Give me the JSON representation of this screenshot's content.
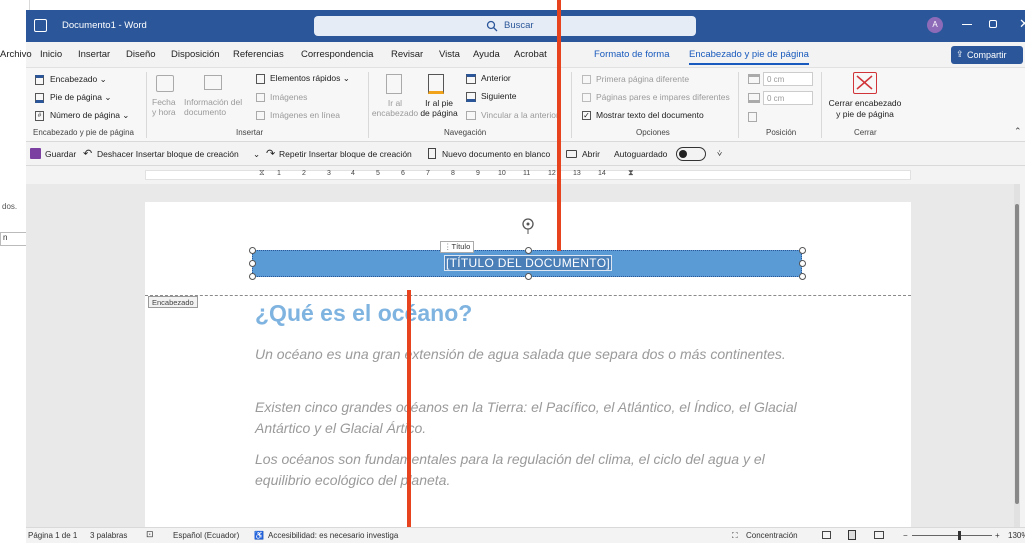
{
  "window": {
    "title": "Documento1 - Word",
    "search_placeholder": "Buscar",
    "avatar_letter": "A"
  },
  "ribbon_tabs": [
    "Archivo",
    "Inicio",
    "Insertar",
    "Diseño",
    "Disposición",
    "Referencias",
    "Correspondencia",
    "Revisar",
    "Vista",
    "Ayuda",
    "Acrobat",
    "Formato de forma",
    "Encabezado y pie de página"
  ],
  "share_label": "Compartir",
  "ribbon": {
    "header_footer_group": {
      "items": [
        "Encabezado",
        "Pie de página",
        "Número de página"
      ],
      "label": "Encabezado y pie de página"
    },
    "insert_group": {
      "date_time": "Fecha y hora",
      "doc_info": "Información del documento",
      "quick_parts": "Elementos rápidos",
      "images": "Imágenes",
      "online_images": "Imágenes en línea",
      "label": "Insertar"
    },
    "navigation_group": {
      "go_header": "Ir al encabezado",
      "go_footer": "Ir al pie de página",
      "previous": "Anterior",
      "next": "Siguiente",
      "link_previous": "Vincular a la anterior",
      "label": "Navegación"
    },
    "options_group": {
      "first_page": "Primera página diferente",
      "odd_even": "Páginas pares e impares diferentes",
      "show_text": "Mostrar texto del documento",
      "label": "Opciones"
    },
    "position_group": {
      "top_value": "0 cm",
      "bottom_value": "0 cm",
      "label": "Posición"
    },
    "close_group": {
      "close_label": "Cerrar encabezado y pie de página",
      "label": "Cerrar"
    }
  },
  "qat": {
    "save": "Guardar",
    "undo": "Deshacer Insertar bloque de creación",
    "redo": "Repetir Insertar bloque de creación",
    "new_blank": "Nuevo documento en blanco",
    "open": "Abrir",
    "autosave": "Autoguardado"
  },
  "ruler_numbers": [
    "1",
    "2",
    "3",
    "4",
    "5",
    "6",
    "7",
    "8",
    "9",
    "10",
    "11",
    "12",
    "13",
    "14"
  ],
  "document": {
    "title_tag": "Título",
    "title_placeholder": "[TÍTULO DEL DOCUMENTO]",
    "header_label": "Encabezado",
    "heading": "¿Qué es el océano?",
    "paragraphs": [
      "Un océano es una gran extensión de agua salada que separa dos o más continentes.",
      "Existen cinco grandes océanos en la Tierra: el Pacífico, el Atlántico, el Índico, el Glacial Antártico y el Glacial Ártico.",
      "Los océanos son fundamentales para la regulación del clima, el ciclo del agua y el equilibrio ecológico del planeta."
    ]
  },
  "statusbar": {
    "page": "Página 1 de 1",
    "words": "3 palabras",
    "language": "Español (Ecuador)",
    "accessibility": "Accesibilidad: es necesario investiga",
    "focus": "Concentración",
    "zoom": "130%"
  },
  "left_fragments": [
    "dos.",
    "n"
  ],
  "colors": {
    "word_blue": "#2b579a",
    "accent_tab": "#185abd",
    "selection_fill": "#5b9bd5",
    "annotation_red": "#e8431f"
  }
}
